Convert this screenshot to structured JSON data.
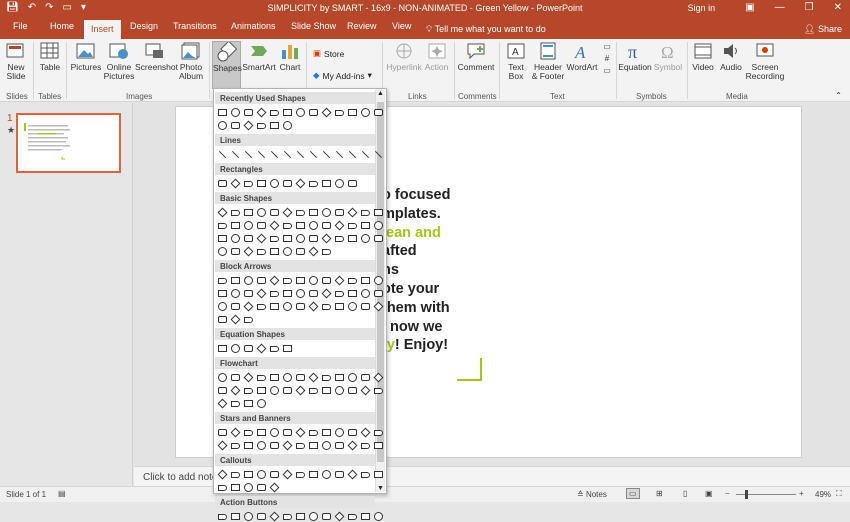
{
  "window": {
    "title": "SIMPLICITY by SMART - 16x9 - NON-ANIMATED - Green Yellow  -  PowerPoint",
    "sign_in": "Sign in"
  },
  "tabs": [
    "File",
    "Home",
    "Insert",
    "Design",
    "Transitions",
    "Animations",
    "Slide Show",
    "Review",
    "View"
  ],
  "tell_me": "Tell me what you want to do",
  "share": "Share",
  "ribbon": {
    "buttons": [
      {
        "name": "new-slide",
        "label": "New\nSlide",
        "icon": "new-slide-icon"
      },
      {
        "name": "table",
        "label": "Table",
        "icon": "table-icon"
      },
      {
        "name": "pictures",
        "label": "Pictures",
        "icon": "pictures-icon"
      },
      {
        "name": "online-pictures",
        "label": "Online\nPictures",
        "icon": "online-pictures-icon"
      },
      {
        "name": "screenshot",
        "label": "Screenshot",
        "icon": "screenshot-icon"
      },
      {
        "name": "photo-album",
        "label": "Photo\nAlbum",
        "icon": "photo-album-icon"
      },
      {
        "name": "shapes",
        "label": "Shapes",
        "icon": "shapes-icon"
      },
      {
        "name": "smartart",
        "label": "SmartArt",
        "icon": "smartart-icon"
      },
      {
        "name": "chart",
        "label": "Chart",
        "icon": "chart-icon"
      },
      {
        "name": "hyperlink",
        "label": "Hyperlink",
        "icon": "hyperlink-icon"
      },
      {
        "name": "action",
        "label": "Action",
        "icon": "action-icon"
      },
      {
        "name": "comment",
        "label": "Comment",
        "icon": "comment-icon"
      },
      {
        "name": "text-box",
        "label": "Text\nBox",
        "icon": "text-box-icon"
      },
      {
        "name": "header-footer",
        "label": "Header\n& Footer",
        "icon": "header-footer-icon"
      },
      {
        "name": "wordart",
        "label": "WordArt",
        "icon": "wordart-icon"
      },
      {
        "name": "equation",
        "label": "Equation",
        "icon": "equation-icon"
      },
      {
        "name": "symbol",
        "label": "Symbol",
        "icon": "symbol-icon"
      },
      {
        "name": "video",
        "label": "Video",
        "icon": "video-icon"
      },
      {
        "name": "audio",
        "label": "Audio",
        "icon": "audio-icon"
      },
      {
        "name": "screen-recording",
        "label": "Screen\nRecording",
        "icon": "screen-recording-icon"
      }
    ],
    "store": "Store",
    "my_addins": "My Add-ins",
    "groups": [
      "Slides",
      "Tables",
      "Images",
      "Links",
      "Comments",
      "Text",
      "Symbols",
      "Media"
    ]
  },
  "shapes_gallery": {
    "categories": [
      "Recently Used Shapes",
      "Lines",
      "Rectangles",
      "Basic Shapes",
      "Block Arrows",
      "Equation Shapes",
      "Flowchart",
      "Stars and Banners",
      "Callouts",
      "Action Buttons"
    ]
  },
  "slide_panel": {
    "number": "1",
    "star": "★"
  },
  "slide": {
    "lines": [
      [
        {
          "t": "o focused",
          "g": false
        }
      ],
      [
        {
          "t": "mplates.",
          "g": false
        }
      ],
      [
        {
          "t": "lean and",
          "g": true
        }
      ],
      [
        {
          "t": "afted",
          "g": false
        }
      ],
      [
        {
          "t": "ns",
          "g": false
        }
      ],
      [
        {
          "t": "ote your",
          "g": false
        }
      ],
      [
        {
          "t": "them with",
          "g": false
        }
      ],
      [
        {
          "t": "l now we",
          "g": false
        }
      ],
      [
        {
          "t": "ty",
          "g": true
        },
        {
          "t": "! Enjoy!",
          "g": false
        }
      ]
    ]
  },
  "notes_placeholder": "Click to add notes",
  "status": {
    "slide_of": "Slide 1 of 1",
    "notes": "Notes",
    "zoom": "49%"
  },
  "colors": {
    "accent": "#b7472a",
    "green": "#a9c416"
  }
}
